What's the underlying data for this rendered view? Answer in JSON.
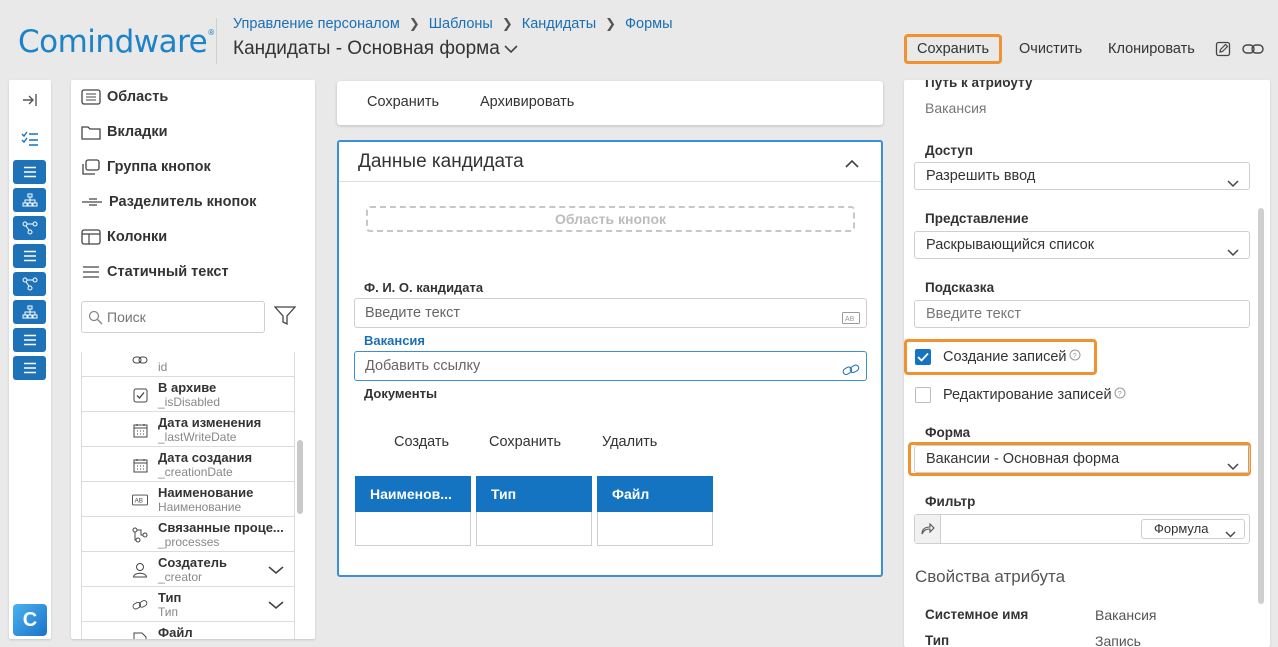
{
  "header": {
    "logo": "Comindware",
    "logo_mark": "®",
    "breadcrumb": [
      "Управление персоналом",
      "Шаблоны",
      "Кандидаты",
      "Формы"
    ],
    "title": "Кандидаты - Основная форма",
    "actions": {
      "save": "Сохранить",
      "clear": "Очистить",
      "clone": "Клонировать"
    },
    "icons": [
      "edit-icon",
      "link-icon"
    ]
  },
  "rail": {
    "icons": [
      "collapse-panel-icon",
      "checklist-icon",
      "form-icon",
      "org-chart-icon",
      "process-icon",
      "form-icon",
      "process-icon",
      "org-chart-icon",
      "form-icon",
      "form-icon"
    ],
    "app_logo": "C"
  },
  "palette": {
    "items": [
      "Область",
      "Вкладки",
      "Группа кнопок",
      "Разделитель кнопок",
      "Колонки",
      "Статичный текст"
    ],
    "search_placeholder": "Поиск",
    "attributes": [
      {
        "name": "",
        "system": "id"
      },
      {
        "name": "В архиве",
        "system": "_isDisabled"
      },
      {
        "name": "Дата изменения",
        "system": "_lastWriteDate"
      },
      {
        "name": "Дата создания",
        "system": "_creationDate"
      },
      {
        "name": "Наименование",
        "system": "Наименование"
      },
      {
        "name": "Связанные проце...",
        "system": "_processes"
      },
      {
        "name": "Создатель",
        "system": "_creator"
      },
      {
        "name": "Тип",
        "system": "Тип"
      },
      {
        "name": "Файл",
        "system": ""
      }
    ]
  },
  "form": {
    "actions": {
      "save": "Сохранить",
      "archive": "Архивировать"
    },
    "card_title": "Данные кандидата",
    "button_area": "Область кнопок",
    "fields": {
      "fio_label": "Ф. И. О. кандидата",
      "fio_placeholder": "Введите текст",
      "vacancy_label": "Вакансия",
      "vacancy_placeholder": "Добавить ссылку",
      "docs_label": "Документы"
    },
    "docs_actions": {
      "create": "Создать",
      "save": "Сохранить",
      "delete": "Удалить"
    },
    "table_columns": [
      "Наименов...",
      "Тип",
      "Файл"
    ]
  },
  "properties": {
    "attr_path_label": "Путь к атрибуту",
    "attr_path_value": "Вакансия",
    "access_label": "Доступ",
    "access_value": "Разрешить ввод",
    "view_label": "Представление",
    "view_value": "Раскрывающийся список",
    "hint_label": "Подсказка",
    "hint_placeholder": "Введите текст",
    "create_records": "Создание записей",
    "create_records_checked": true,
    "edit_records": "Редактирование записей",
    "edit_records_checked": false,
    "form_label": "Форма",
    "form_value": "Вакансии - Основная форма",
    "filter_label": "Фильтр",
    "filter_mode": "Формула",
    "section_title": "Свойства атрибута",
    "system_name_label": "Системное имя",
    "system_name_value": "Вакансия",
    "type_label": "Тип",
    "type_value": "Запись"
  },
  "colors": {
    "accent": "#1474c2",
    "highlight": "#f0922f",
    "logo": "#1d83c9"
  }
}
